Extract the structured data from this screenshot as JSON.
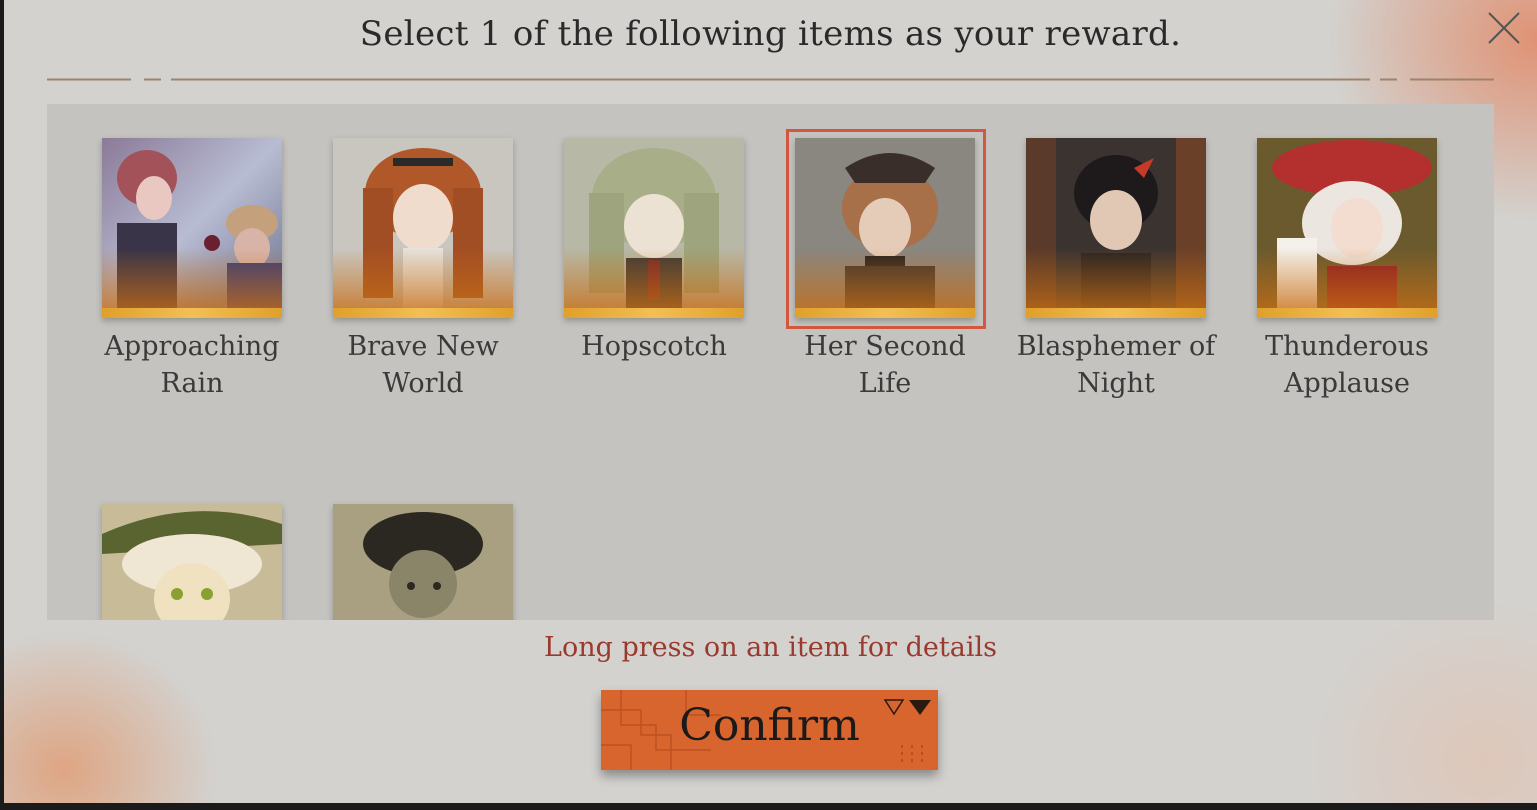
{
  "dialog": {
    "title": "Select 1 of the following items as your reward.",
    "close_icon": "close-icon",
    "hint": "Long press on an item for details",
    "confirm_label": "Confirm"
  },
  "items": [
    {
      "name": "Approaching Rain",
      "line1": "Approaching",
      "line2": "Rain",
      "selected": false
    },
    {
      "name": "Brave New World",
      "line1": "Brave New",
      "line2": "World",
      "selected": false
    },
    {
      "name": "Hopscotch",
      "line1": "Hopscotch",
      "line2": "",
      "selected": false
    },
    {
      "name": "Her Second Life",
      "line1": "Her Second",
      "line2": "Life",
      "selected": true
    },
    {
      "name": "Blasphemer of Night",
      "line1": "Blasphemer of",
      "line2": "Night",
      "selected": false
    },
    {
      "name": "Thunderous Applause",
      "line1": "Thunderous",
      "line2": "Applause",
      "selected": false
    },
    {
      "name": "",
      "line1": "",
      "line2": "",
      "selected": false
    },
    {
      "name": "",
      "line1": "",
      "line2": "",
      "selected": false
    }
  ],
  "colors": {
    "accent": "#d8642e",
    "selected_border": "#d2573f",
    "hint_text": "#9a3a2e",
    "rarity_bar": "#f0b444"
  }
}
